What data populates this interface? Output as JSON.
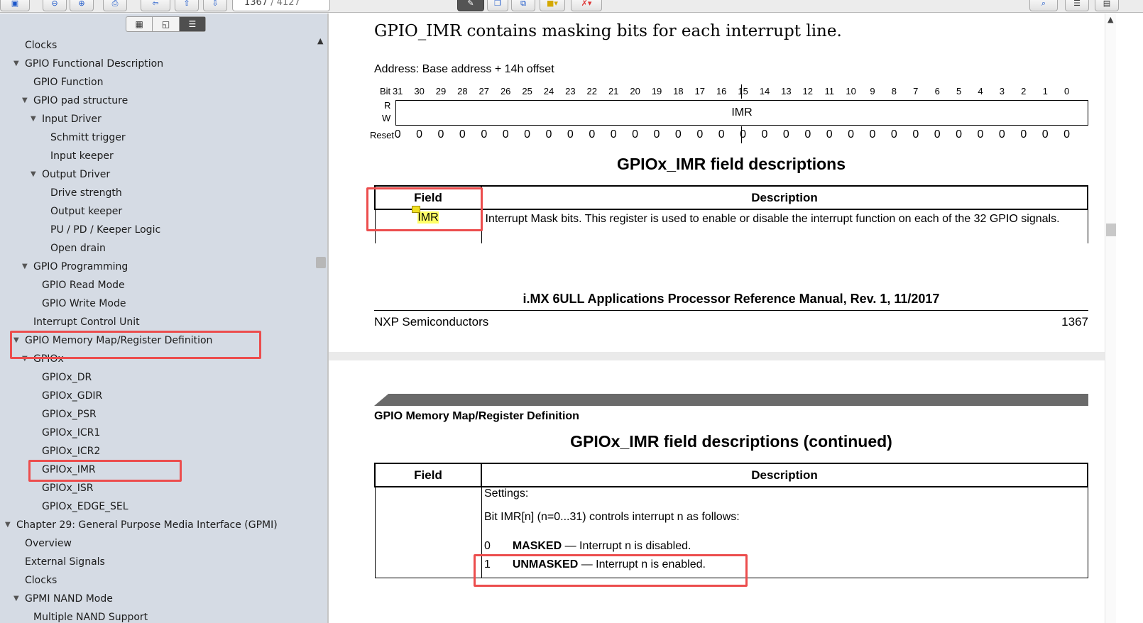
{
  "toolbar": {
    "page_current": "1367",
    "page_total": "/ 4127"
  },
  "sidebar": {
    "tabs": [
      "▦",
      "◱",
      "☰"
    ],
    "items": [
      {
        "label": "Clocks"
      },
      {
        "label": "GPIO Functional Description"
      },
      {
        "label": "GPIO Function"
      },
      {
        "label": "GPIO pad structure"
      },
      {
        "label": "Input Driver"
      },
      {
        "label": "Schmitt trigger"
      },
      {
        "label": "Input keeper"
      },
      {
        "label": "Output Driver"
      },
      {
        "label": "Drive strength"
      },
      {
        "label": "Output keeper"
      },
      {
        "label": "PU / PD / Keeper Logic"
      },
      {
        "label": "Open drain"
      },
      {
        "label": "GPIO Programming"
      },
      {
        "label": "GPIO Read Mode"
      },
      {
        "label": "GPIO Write Mode"
      },
      {
        "label": "Interrupt Control Unit"
      },
      {
        "label": "GPIO Memory Map/Register Definition"
      },
      {
        "label": "GPIOx"
      },
      {
        "label": "GPIOx_DR"
      },
      {
        "label": "GPIOx_GDIR"
      },
      {
        "label": "GPIOx_PSR"
      },
      {
        "label": "GPIOx_ICR1"
      },
      {
        "label": "GPIOx_ICR2"
      },
      {
        "label": "GPIOx_IMR"
      },
      {
        "label": "GPIOx_ISR"
      },
      {
        "label": "GPIOx_EDGE_SEL"
      },
      {
        "label": "Chapter 29: General Purpose Media Interface (GPMI)"
      },
      {
        "label": "Overview"
      },
      {
        "label": "External Signals"
      },
      {
        "label": "Clocks"
      },
      {
        "label": "GPMI NAND Mode"
      },
      {
        "label": "Multiple NAND Support"
      }
    ]
  },
  "doc": {
    "heading": "GPIO_IMR contains masking bits for each interrupt line.",
    "address": "Address: Base address + 14h offset",
    "bit_label": "Bit",
    "bits": [
      "31",
      "30",
      "29",
      "28",
      "27",
      "26",
      "25",
      "24",
      "23",
      "22",
      "21",
      "20",
      "19",
      "18",
      "17",
      "16",
      "15",
      "14",
      "13",
      "12",
      "11",
      "10",
      "9",
      "8",
      "7",
      "6",
      "5",
      "4",
      "3",
      "2",
      "1",
      "0"
    ],
    "r_label": "R",
    "w_label": "W",
    "reg_name": "IMR",
    "reset_label": "Reset",
    "reset_values": [
      "0",
      "0",
      "0",
      "0",
      "0",
      "0",
      "0",
      "0",
      "0",
      "0",
      "0",
      "0",
      "0",
      "0",
      "0",
      "0",
      "0",
      "0",
      "0",
      "0",
      "0",
      "0",
      "0",
      "0",
      "0",
      "0",
      "0",
      "0",
      "0",
      "0",
      "0",
      "0"
    ],
    "table1": {
      "title": "GPIOx_IMR field descriptions",
      "col_field": "Field",
      "col_desc": "Description",
      "row_field": "IMR",
      "row_desc": "Interrupt Mask bits. This register is used to enable or disable the interrupt function on each of the 32 GPIO signals."
    },
    "footer": {
      "manual": "i.MX 6ULL Applications Processor Reference Manual, Rev. 1, 11/2017",
      "company": "NXP Semiconductors",
      "page": "1367"
    },
    "section": "GPIO Memory Map/Register Definition",
    "table2": {
      "title": "GPIOx_IMR field descriptions (continued)",
      "col_field": "Field",
      "col_desc": "Description",
      "settings": "Settings:",
      "bit_line": "Bit IMR[n] (n=0...31) controls interrupt n as follows:",
      "opt0_num": "0",
      "opt0_name": "MASKED",
      "opt0_text": "— Interrupt n is disabled.",
      "opt1_num": "1",
      "opt1_name": "UNMASKED",
      "opt1_text": "— Interrupt n is enabled."
    }
  }
}
